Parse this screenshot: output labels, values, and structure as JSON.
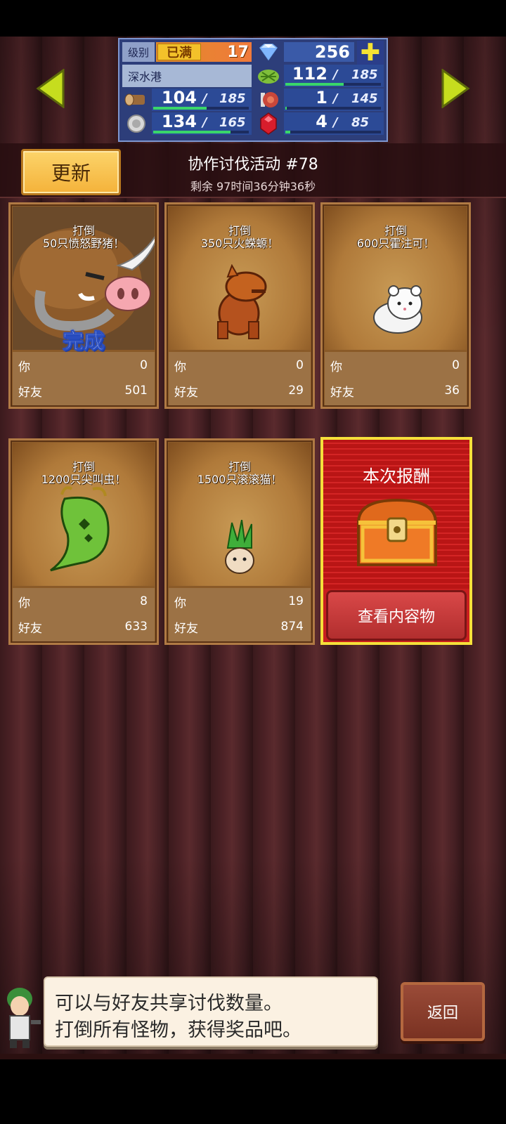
{
  "status": {
    "level_label": "级别",
    "level_badge": "已满",
    "level_value": "17",
    "gems": "256",
    "town_name": "深水港",
    "resources": {
      "grass": {
        "current": "112",
        "max": "185",
        "fraction": 0.61
      },
      "wood": {
        "current": "104",
        "max": "185",
        "fraction": 0.56
      },
      "meat": {
        "current": "1",
        "max": "145",
        "fraction": 0.01
      },
      "ore": {
        "current": "134",
        "max": "165",
        "fraction": 0.81
      },
      "ruby": {
        "current": "4",
        "max": "85",
        "fraction": 0.05
      }
    },
    "separator": "/"
  },
  "event": {
    "update_label": "更新",
    "title": "协作讨伐活动 #78",
    "remaining": "剩余 97时间36分钟36秒"
  },
  "labels": {
    "you": "你",
    "friends": "好友",
    "defeat": "打倒"
  },
  "cards": [
    {
      "target": "50只愤怒野猪！",
      "you": "0",
      "friends": "501",
      "done": "完成",
      "icon": "angry-boar-icon"
    },
    {
      "target": "350只火蝾螈！",
      "you": "0",
      "friends": "29",
      "icon": "fire-salamander-icon"
    },
    {
      "target": "600只霍注可！",
      "you": "0",
      "friends": "36",
      "icon": "white-fox-icon"
    },
    {
      "target": "1200只尖叫虫！",
      "you": "8",
      "friends": "633",
      "icon": "screaming-bug-icon"
    },
    {
      "target": "1500只滚滚猫！",
      "you": "19",
      "friends": "874",
      "icon": "rolling-cat-icon"
    }
  ],
  "reward": {
    "title": "本次报酬",
    "view_label": "查看内容物",
    "icon": "treasure-chest-icon"
  },
  "dialogue": {
    "line1": "可以与好友共享讨伐数量。",
    "line2": "打倒所有怪物，获得奖品吧。"
  },
  "back_label": "返回"
}
